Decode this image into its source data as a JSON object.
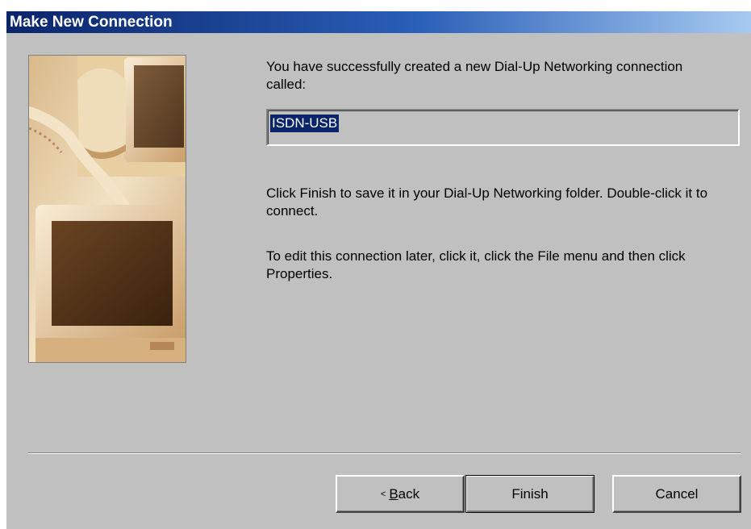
{
  "window": {
    "title": "Make New Connection"
  },
  "wizard": {
    "image": "computer-monitors-illustration",
    "message_line1": "You have successfully created a new Dial-Up Networking connection called:",
    "connection_name": "ISDN-USB",
    "message_finish": "Click Finish to save it in your Dial-Up Networking folder. Double-click it to connect.",
    "message_edit": "To edit this connection later, click it, click the File menu and then click Properties."
  },
  "buttons": {
    "back_arrow": "<",
    "back_hotkey": "B",
    "back_rest": "ack",
    "finish": "Finish",
    "cancel": "Cancel"
  },
  "colors": {
    "title_start": "#0a246a",
    "title_end": "#a6caf0",
    "face": "#c0c0c0",
    "selection": "#0a246a"
  }
}
